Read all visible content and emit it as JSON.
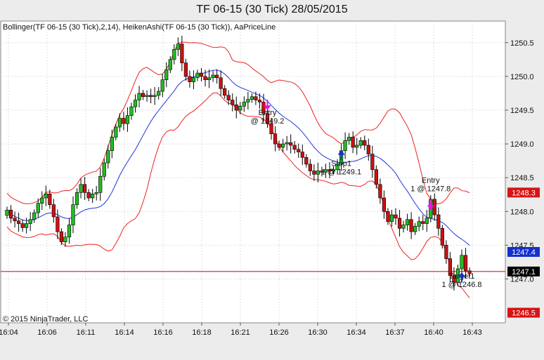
{
  "window": {
    "title": "TF 06-15 (30 Tick)  28/05/2015"
  },
  "legend": {
    "indicators": "Bollinger(TF 06-15 (30 Tick),2,14), HeikenAshi(TF 06-15 (30 Tick)), AaPriceLine"
  },
  "copyright": "© 2015 NinjaTrader, LLC",
  "colors": {
    "up_candle": "#22bb22",
    "down_candle": "#cc1111",
    "bollinger_band": "#ee2222",
    "middle_band": "#2233dd",
    "price_line": "#cc0000",
    "marker_magenta": "#ee11ee",
    "marker_blue": "#1133cc"
  },
  "chart_data": {
    "type": "candlestick",
    "x_ticks": [
      "16:04",
      "16:06",
      "16:11",
      "16:14",
      "16:16",
      "16:18",
      "16:21",
      "16:26",
      "16:30",
      "16:34",
      "16:37",
      "16:40",
      "16:43"
    ],
    "y_ticks": [
      "1250.5",
      "1250.0",
      "1249.5",
      "1249.0",
      "1248.5",
      "1248.0",
      "1247.5",
      "1247.0"
    ],
    "ylim": [
      1246.35,
      1250.82
    ],
    "price_labels": [
      {
        "text": "1248.3",
        "value": 1248.28,
        "color": "red"
      },
      {
        "text": "1247.4",
        "value": 1247.4,
        "color": "blue"
      },
      {
        "text": "1247.1",
        "value": 1247.11,
        "color": "black"
      },
      {
        "text": "1246.5",
        "value": 1246.5,
        "color": "red"
      }
    ],
    "price_line_value": 1247.11,
    "annotations": [
      {
        "line1": "Entry",
        "line2": "@ 1249.2",
        "bar": 67,
        "value": 1249.3,
        "arrow": "down",
        "arrow_value": 1249.53
      },
      {
        "line1": "Stop1",
        "line2": "1 @ 1249.1",
        "bar": 86,
        "value": 1248.55,
        "arrow": "up",
        "arrow_value": 1248.88
      },
      {
        "line1": "Entry",
        "line2": "1 @ 1247.8",
        "bar": 109,
        "value": 1248.3,
        "arrow": "down",
        "arrow_value": 1248.05
      },
      {
        "line1": "Target1",
        "line2": "1 @ 1246.8",
        "bar": 117,
        "value": 1246.88,
        "arrow": "up",
        "arrow_value": 1247.07
      }
    ],
    "bars": [
      [
        1247.94,
        1248.02
      ],
      [
        1248.02,
        1247.9
      ],
      [
        1247.9,
        1247.86
      ],
      [
        1247.86,
        1247.82
      ],
      [
        1247.82,
        1247.76
      ],
      [
        1247.76,
        1247.82
      ],
      [
        1247.82,
        1247.88
      ],
      [
        1247.88,
        1247.98
      ],
      [
        1247.98,
        1248.12
      ],
      [
        1248.12,
        1248.2
      ],
      [
        1248.2,
        1248.26
      ],
      [
        1248.26,
        1248.1
      ],
      [
        1248.1,
        1247.92
      ],
      [
        1247.92,
        1247.7
      ],
      [
        1247.7,
        1247.55
      ],
      [
        1247.55,
        1247.62
      ],
      [
        1247.62,
        1247.8
      ],
      [
        1247.8,
        1248.1
      ],
      [
        1248.1,
        1248.28
      ],
      [
        1248.28,
        1248.4
      ],
      [
        1248.4,
        1248.28
      ],
      [
        1248.28,
        1248.2
      ],
      [
        1248.2,
        1248.26
      ],
      [
        1248.26,
        1248.28
      ],
      [
        1248.28,
        1248.52
      ],
      [
        1248.52,
        1248.72
      ],
      [
        1248.72,
        1248.9
      ],
      [
        1248.9,
        1249.1
      ],
      [
        1249.1,
        1249.25
      ],
      [
        1249.25,
        1249.38
      ],
      [
        1249.38,
        1249.3
      ],
      [
        1249.3,
        1249.42
      ],
      [
        1249.42,
        1249.55
      ],
      [
        1249.55,
        1249.65
      ],
      [
        1249.65,
        1249.75
      ],
      [
        1249.75,
        1249.7
      ],
      [
        1249.7,
        1249.72
      ],
      [
        1249.72,
        1249.7
      ],
      [
        1249.7,
        1249.72
      ],
      [
        1249.72,
        1249.78
      ],
      [
        1249.78,
        1249.95
      ],
      [
        1249.95,
        1250.1
      ],
      [
        1250.1,
        1250.25
      ],
      [
        1250.25,
        1250.4
      ],
      [
        1250.4,
        1250.48
      ],
      [
        1250.48,
        1250.2
      ],
      [
        1250.2,
        1250.0
      ],
      [
        1250.0,
        1249.92
      ],
      [
        1249.92,
        1249.98
      ],
      [
        1249.98,
        1250.05
      ],
      [
        1250.05,
        1250.0
      ],
      [
        1250.0,
        1249.95
      ],
      [
        1249.95,
        1249.98
      ],
      [
        1249.98,
        1250.02
      ],
      [
        1250.02,
        1249.98
      ],
      [
        1249.98,
        1249.82
      ],
      [
        1249.82,
        1249.72
      ],
      [
        1249.72,
        1249.65
      ],
      [
        1249.65,
        1249.58
      ],
      [
        1249.58,
        1249.5
      ],
      [
        1249.5,
        1249.56
      ],
      [
        1249.56,
        1249.62
      ],
      [
        1249.62,
        1249.66
      ],
      [
        1249.66,
        1249.7
      ],
      [
        1249.7,
        1249.65
      ],
      [
        1249.65,
        1249.62
      ],
      [
        1249.62,
        1249.45
      ],
      [
        1249.45,
        1249.3
      ],
      [
        1249.3,
        1249.15
      ],
      [
        1249.15,
        1249.0
      ],
      [
        1249.0,
        1248.95
      ],
      [
        1248.95,
        1249.0
      ],
      [
        1249.0,
        1249.02
      ],
      [
        1249.02,
        1248.98
      ],
      [
        1248.98,
        1248.92
      ],
      [
        1248.92,
        1248.88
      ],
      [
        1248.88,
        1248.8
      ],
      [
        1248.8,
        1248.7
      ],
      [
        1248.7,
        1248.6
      ],
      [
        1248.6,
        1248.55
      ],
      [
        1248.55,
        1248.6
      ],
      [
        1248.6,
        1248.58
      ],
      [
        1248.58,
        1248.62
      ],
      [
        1248.62,
        1248.6
      ],
      [
        1248.6,
        1248.62
      ],
      [
        1248.62,
        1248.7
      ],
      [
        1248.7,
        1248.9
      ],
      [
        1248.9,
        1249.05
      ],
      [
        1249.05,
        1249.1
      ],
      [
        1249.1,
        1248.95
      ],
      [
        1248.95,
        1248.98
      ],
      [
        1248.98,
        1249.05
      ],
      [
        1249.05,
        1248.98
      ],
      [
        1248.98,
        1248.85
      ],
      [
        1248.85,
        1248.62
      ],
      [
        1248.62,
        1248.4
      ],
      [
        1248.4,
        1248.2
      ],
      [
        1248.2,
        1248.0
      ],
      [
        1248.0,
        1247.85
      ],
      [
        1247.85,
        1247.95
      ],
      [
        1247.95,
        1247.9
      ],
      [
        1247.9,
        1247.75
      ],
      [
        1247.75,
        1247.8
      ],
      [
        1247.8,
        1247.88
      ],
      [
        1247.88,
        1247.7
      ],
      [
        1247.7,
        1247.78
      ],
      [
        1247.78,
        1247.85
      ],
      [
        1247.85,
        1247.82
      ],
      [
        1247.82,
        1247.9
      ],
      [
        1247.9,
        1248.18
      ],
      [
        1248.18,
        1247.95
      ],
      [
        1247.95,
        1247.75
      ],
      [
        1247.75,
        1247.5
      ],
      [
        1247.5,
        1247.3
      ],
      [
        1247.3,
        1247.05
      ],
      [
        1247.05,
        1246.95
      ],
      [
        1246.95,
        1247.15
      ],
      [
        1247.15,
        1247.35
      ],
      [
        1247.35,
        1247.12
      ],
      [
        1247.12,
        1247.08
      ]
    ]
  }
}
